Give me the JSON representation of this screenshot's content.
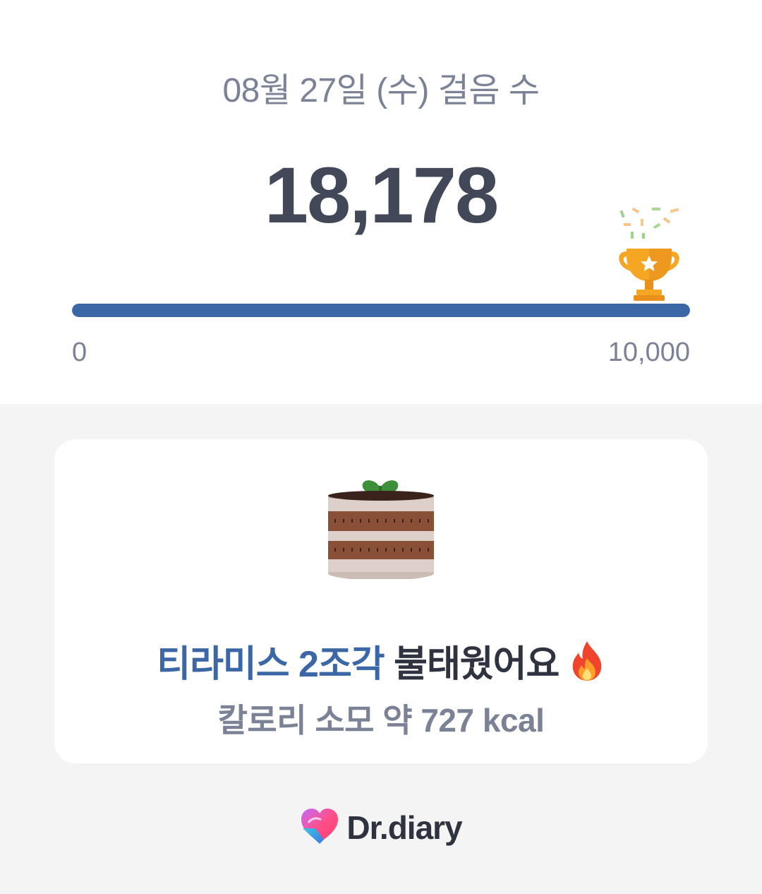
{
  "header": {
    "date_title": "08월 27일 (수) 걸음 수",
    "steps": "18,178"
  },
  "progress": {
    "min_label": "0",
    "max_label": "10,000",
    "fill_fraction": 1.0,
    "bar_color": "#3c67a6",
    "goal_icon": "trophy-icon"
  },
  "card": {
    "food_icon": "tiramisu-cake-icon",
    "headline_highlight": "티라미스 2조각",
    "headline_rest": "불태웠어요",
    "headline_icon": "fire-icon",
    "calorie_line": "칼로리 소모 약 727 kcal"
  },
  "brand": {
    "logo_icon": "heart-logo-icon",
    "name": "Dr.diary"
  },
  "colors": {
    "accent": "#3c67a6",
    "text_dark": "#424858",
    "text_muted": "#7b8296",
    "background": "#f4f4f4"
  }
}
